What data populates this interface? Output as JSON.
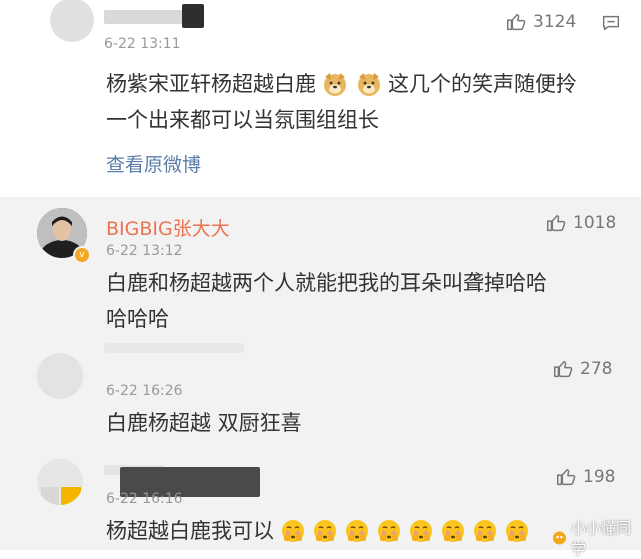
{
  "comments": [
    {
      "time": "6-22 13:11",
      "likes": "3124",
      "text_line1": "杨紫宋亚轩杨超越白鹿",
      "text_line1b": "这几个的笑声随便拎",
      "text_line2": "一个出来都可以当氛围组组长",
      "view_original": "查看原微博"
    },
    {
      "name": "BIGBIG张大大",
      "time": "6-22 13:12",
      "likes": "1018",
      "text_line1": "白鹿和杨超越两个人就能把我的耳朵叫聋掉哈哈",
      "text_line2": "哈哈哈"
    },
    {
      "time": "6-22 16:26",
      "likes": "278",
      "text": "白鹿杨超越 双厨狂喜"
    },
    {
      "time": "6-22 16:16",
      "likes": "198",
      "text": "杨超越白鹿我可以"
    }
  ],
  "watermark": "小小懂同学",
  "colors": {
    "name_orange": "#eb7350",
    "section_bg": "#f2f2f2",
    "link_blue": "#5b7ea8",
    "verified_badge": "#f5a623"
  }
}
